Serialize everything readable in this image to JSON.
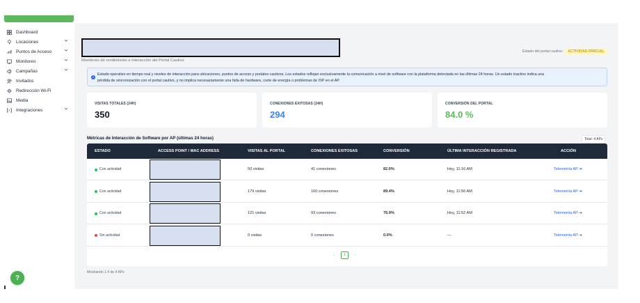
{
  "sidebar": {
    "brand_label": "",
    "items": [
      {
        "label": "Dashboard",
        "icon": "grid-icon",
        "has_chevron": false
      },
      {
        "label": "Locaciones",
        "icon": "location-pin-icon",
        "has_chevron": true
      },
      {
        "label": "Puntos de Acceso",
        "icon": "wifi-access-point-icon",
        "has_chevron": true
      },
      {
        "label": "Monitoreo",
        "icon": "monitor-icon",
        "has_chevron": true
      },
      {
        "label": "Campañas",
        "icon": "campaign-icon",
        "has_chevron": true
      },
      {
        "label": "Invitados",
        "icon": "users-icon",
        "has_chevron": false
      },
      {
        "label": "Redirección Wi-Fi",
        "icon": "redirect-icon",
        "has_chevron": false
      },
      {
        "label": "Media",
        "icon": "media-icon",
        "has_chevron": false
      },
      {
        "label": "Integraciones",
        "icon": "integrations-icon",
        "has_chevron": true
      }
    ],
    "help_label": "?"
  },
  "header": {
    "subtitle": "Monitoreo de rendimiento e interacción del Portal Cautivo",
    "portal_status_label": "Estado del portal cautivo:",
    "portal_status_value": "ACTIVIDAD PARCIAL"
  },
  "info": {
    "icon": "info-icon",
    "line1": "Estado operativo en tiempo real y niveles de interacción para ubicaciones, puntos de acceso y portales cautivos. Los estados reflejan exclusivamente la comunicación a nivel de software con la plataforma detectada en las últimas 24 horas. Un estado inactivo indica una",
    "line2": "pérdida de sincronización con el portal cautivo, y no implica necesariamente una falla de hardware, corte de energía o problemas de ISP en el AP."
  },
  "stats": [
    {
      "label": "VISITAS TOTALES (24H)",
      "value": "350",
      "color": "#111827"
    },
    {
      "label": "CONEXIONES EXITOSAS (24H)",
      "value": "294",
      "color": "#3b82f6"
    },
    {
      "label": "CONVERSIÓN DEL PORTAL",
      "value": "84.0 %",
      "color": "#5cb85c"
    }
  ],
  "metrics": {
    "title": "Métricas de Interacción de Software por AP (últimas 24 horas)",
    "total_badge": "Total: 4 APs"
  },
  "table": {
    "headers": [
      "ESTADO",
      "ACCESS POINT / MAC ADDRESS",
      "VISITAS AL PORTAL",
      "CONEXIONES EXITOSAS",
      "CONVERSIÓN",
      "ÚLTIMA INTERACCIÓN REGISTRADA",
      "ACCIÓN"
    ],
    "rows": [
      {
        "state": "Con actividad",
        "state_color": "#22c55e",
        "visits": "50 visitas",
        "connections": "41 conexiones",
        "conversion": "82.0%",
        "last": "Hoy, 11:16 AM",
        "action": "Telemetría AP ➜"
      },
      {
        "state": "Con actividad",
        "state_color": "#22c55e",
        "visits": "179 visitas",
        "connections": "160 conexiones",
        "conversion": "89.4%",
        "last": "Hoy, 11:56 AM",
        "action": "Telemetría AP ➜"
      },
      {
        "state": "Con actividad",
        "state_color": "#22c55e",
        "visits": "121 visitas",
        "connections": "93 conexiones",
        "conversion": "76.9%",
        "last": "Hoy, 11:52 AM",
        "action": "Telemetría AP ➜"
      },
      {
        "state": "Sin actividad",
        "state_color": "#ef4444",
        "visits": "0 visitas",
        "connections": "0 conexiones",
        "conversion": "0.0%",
        "last": "—",
        "action": "Telemetría AP ➜"
      }
    ]
  },
  "pagination": {
    "prev": "‹",
    "current": "1",
    "next": "›"
  },
  "footer": {
    "showing": "Mostrando 1-4 de 4 APs"
  }
}
